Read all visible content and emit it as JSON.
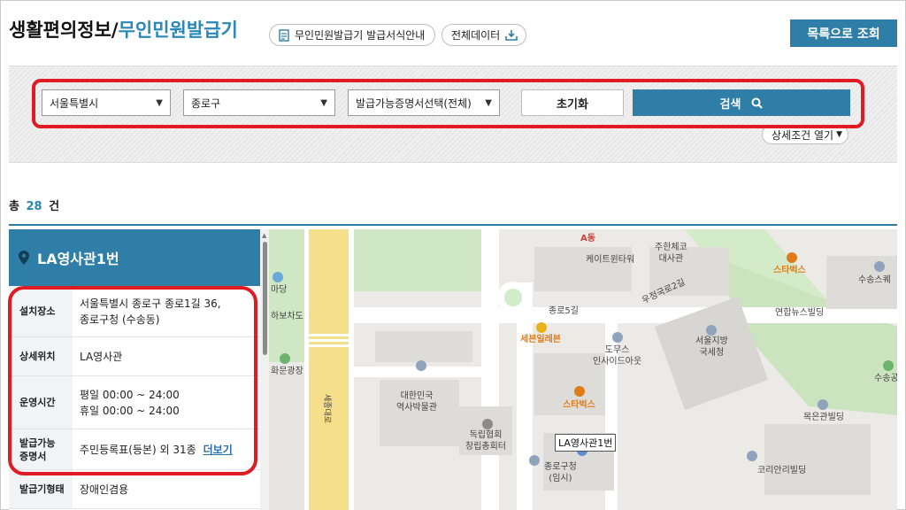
{
  "header": {
    "title_main": "생활편의정보",
    "title_slash": "/",
    "title_sub": "무인민원발급기",
    "guide_button": "무인민원발급기 발급서식안내",
    "all_data_button": "전체데이터",
    "list_button": "목록으로 조회"
  },
  "search": {
    "city_select": "서울특별시",
    "gu_select": "종로구",
    "doc_select": "발급가능증명서선택(전체)",
    "reset_button": "초기화",
    "search_button": "검색",
    "detail_toggle": "상세조건 열기"
  },
  "result": {
    "count_prefix": "총",
    "count": "28",
    "count_suffix": "건"
  },
  "location": {
    "name": "LA영사관1번",
    "rows": {
      "address_label": "설치장소",
      "address_line1": "서울특별시 종로구 종로1길 36,",
      "address_line2": "종로구청 (수송동)",
      "detail_label": "상세위치",
      "detail_value": "LA영사관",
      "hours_label": "운영시간",
      "hours_weekday": "평일 00:00 ~ 24:00",
      "hours_holiday": "휴일 00:00 ~ 24:00",
      "docs_label_1": "발급가능",
      "docs_label_2": "증명서",
      "docs_value": "주민등록표(등본) 외 31종",
      "docs_more": "더보기",
      "type_label": "발급기형태",
      "type_value": "장애인겸용"
    }
  },
  "map": {
    "labels": {
      "a_dong": "A동",
      "kate_tower": "케이트윈타워",
      "czech_1": "주한체코",
      "czech_2": "대사관",
      "starbucks_1": "스타벅스",
      "susong": "수송스퀘",
      "jongno_5gil": "종로5길",
      "ujeongguk_2gil": "우정국로2길",
      "yonhap": "연합뉴스빌딩",
      "seven_eleven": "세븐일레븐",
      "domus_1": "도무스",
      "domus_2": "인사이드아웃",
      "tax_1": "서울지방",
      "tax_2": "국세청",
      "susongdong": "수송공",
      "history_1": "대한민국",
      "history_2": "역사박물관",
      "starbucks_2": "스타벅스",
      "mokeun": "목은관빌딩",
      "independence_1": "독립협회",
      "independence_2": "창립총회터",
      "marker": "LA영사관1번",
      "gucheong_1": "종로구청",
      "gucheong_2": "(임시)",
      "korean_re": "코리안리빌딩",
      "sejong_road": "세종대로",
      "madang": "마당",
      "haboktaecha": "하보차도",
      "plaza": "화문광장"
    }
  },
  "colors": {
    "accent": "#2f7ea8",
    "highlight": "#e01b22"
  }
}
